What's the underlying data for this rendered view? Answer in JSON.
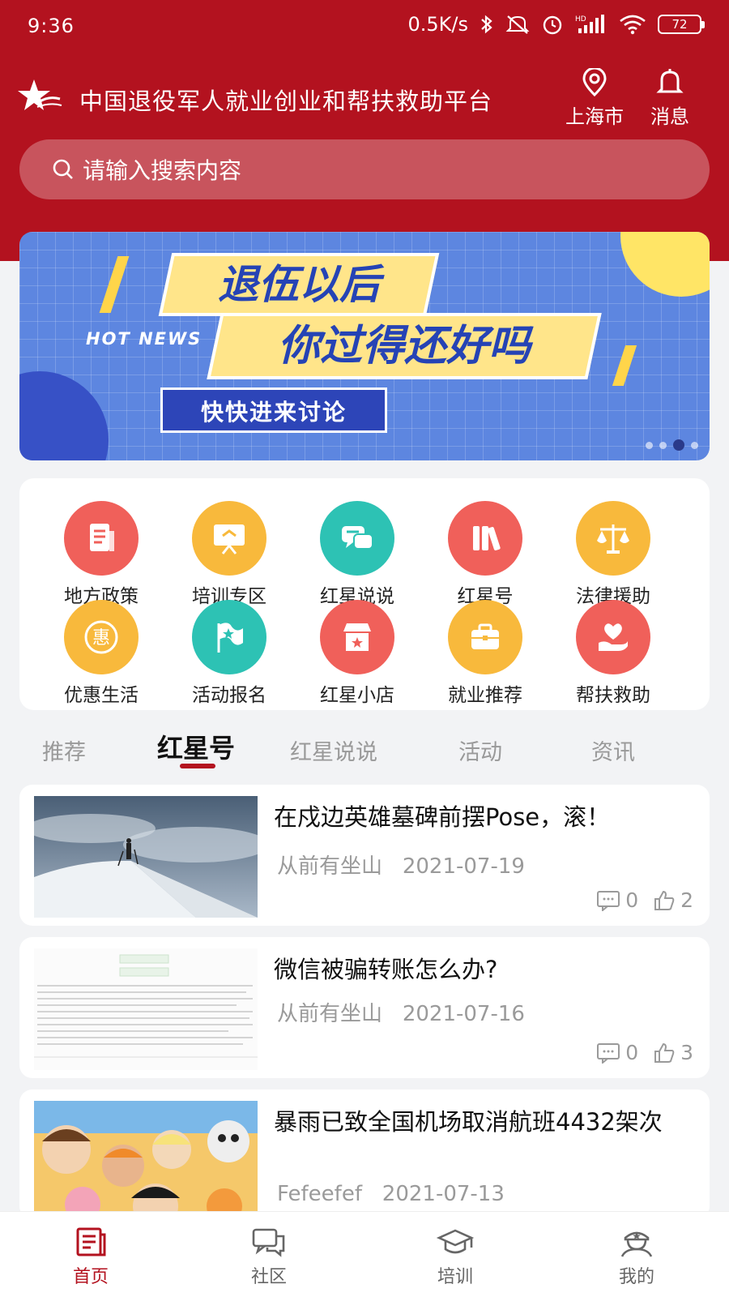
{
  "status_bar": {
    "time": "9:36",
    "net_speed": "0.5K/s",
    "battery": "72"
  },
  "app": {
    "title": "中国退役军人就业创业和帮扶救助平台",
    "location_label": "上海市",
    "message_label": "消息"
  },
  "search": {
    "placeholder": "请输入搜索内容"
  },
  "banner": {
    "line1": "退伍以后",
    "line2": "你过得还好吗",
    "tag": "HOT NEWS",
    "button": "快快进来讨论",
    "slides": 4,
    "active_slide": 3
  },
  "grid": {
    "items": [
      {
        "label": "地方政策",
        "icon": "document-icon",
        "color": "#f0605a"
      },
      {
        "label": "培训专区",
        "icon": "presentation-board-icon",
        "color": "#f8b93c"
      },
      {
        "label": "红星说说",
        "icon": "chat-bubbles-icon",
        "color": "#2dc2b4"
      },
      {
        "label": "红星号",
        "icon": "books-icon",
        "color": "#f0605a"
      },
      {
        "label": "法律援助",
        "icon": "scales-icon",
        "color": "#f8b93c"
      },
      {
        "label": "优惠生活",
        "icon": "discount-icon",
        "color": "#f8b93c"
      },
      {
        "label": "活动报名",
        "icon": "flag-icon",
        "color": "#2dc2b4"
      },
      {
        "label": "红星小店",
        "icon": "shop-icon",
        "color": "#f0605a"
      },
      {
        "label": "就业推荐",
        "icon": "briefcase-icon",
        "color": "#f8b93c"
      },
      {
        "label": "帮扶救助",
        "icon": "heart-hand-icon",
        "color": "#f0605a"
      }
    ]
  },
  "tabs": [
    "推荐",
    "红星号",
    "红星说说",
    "活动",
    "资讯"
  ],
  "active_tab": "红星号",
  "articles": [
    {
      "title": "在戍边英雄墓碑前摆Pose，滚！",
      "author": "从前有坐山",
      "date": "2021-07-19",
      "comments": "0",
      "likes": "2"
    },
    {
      "title": "微信被骗转账怎么办?",
      "author": "从前有坐山",
      "date": "2021-07-16",
      "comments": "0",
      "likes": "3"
    },
    {
      "title": "暴雨已致全国机场取消航班4432架次",
      "author": "Fefeefef",
      "date": "2021-07-13"
    }
  ],
  "bottom_nav": [
    {
      "label": "首页",
      "icon": "home-document-icon",
      "active": true
    },
    {
      "label": "社区",
      "icon": "community-chat-icon"
    },
    {
      "label": "培训",
      "icon": "graduation-cap-icon"
    },
    {
      "label": "我的",
      "icon": "soldier-profile-icon"
    }
  ],
  "colors": {
    "brand_red": "#b3121f",
    "banner_blue": "#5d86e0",
    "banner_yellow": "#ffe58a"
  }
}
